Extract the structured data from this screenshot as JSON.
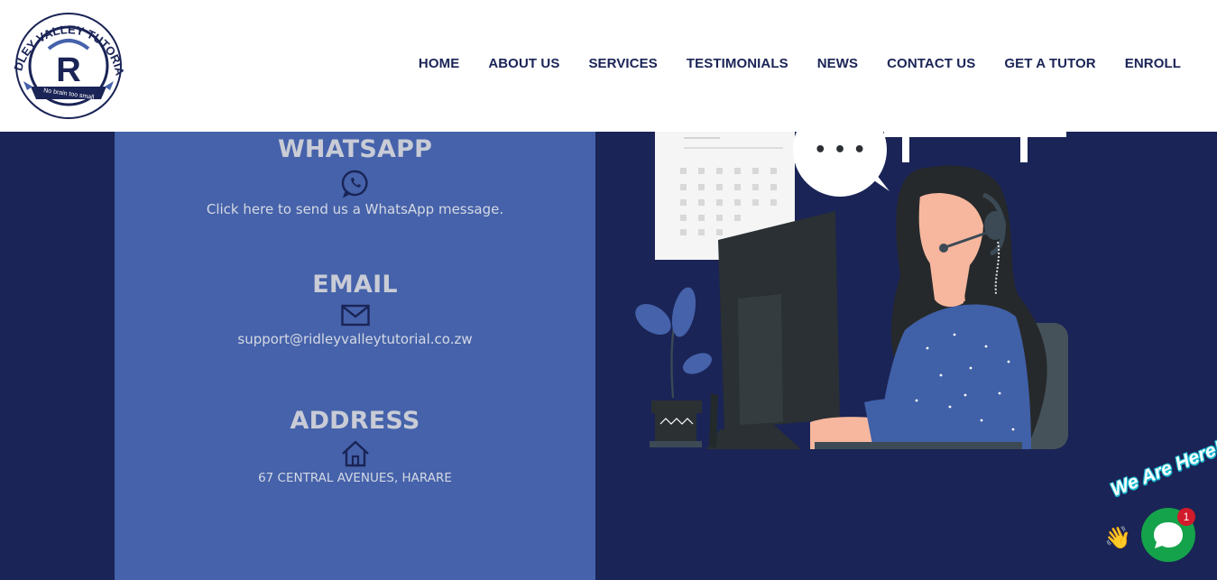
{
  "brand": {
    "logo_text": "RIDLEY VALLEY TUTORIAL",
    "logo_tagline": "No brain too small",
    "logo_monogram": "R"
  },
  "nav": {
    "items": [
      {
        "label": "HOME"
      },
      {
        "label": "ABOUT US"
      },
      {
        "label": "SERVICES"
      },
      {
        "label": "TESTIMONIALS"
      },
      {
        "label": "NEWS"
      },
      {
        "label": "CONTACT US"
      },
      {
        "label": "GET A TUTOR"
      },
      {
        "label": "ENROLL"
      }
    ]
  },
  "contact": {
    "whatsapp": {
      "title": "WHATSAPP",
      "text": "Click here to send us a WhatsApp message.",
      "icon": "whatsapp-icon"
    },
    "email": {
      "title": "EMAIL",
      "text": "support@ridleyvalleytutorial.co.zw",
      "icon": "envelope-icon"
    },
    "address": {
      "title": "ADDRESS",
      "text": "67 CENTRAL AVENUES, HARARE",
      "icon": "home-icon"
    }
  },
  "illustration": {
    "speech_bubble": "• • •"
  },
  "chat_widget": {
    "label": "We Are Here!",
    "badge_count": "1",
    "emoji": "👋",
    "icon": "chat-bubble-icon"
  },
  "colors": {
    "page_background": "#1a2456",
    "panel_background": "#4562aa",
    "nav_text": "#1a2456",
    "chat_button": "#14a34a",
    "badge": "#d11a2a"
  }
}
